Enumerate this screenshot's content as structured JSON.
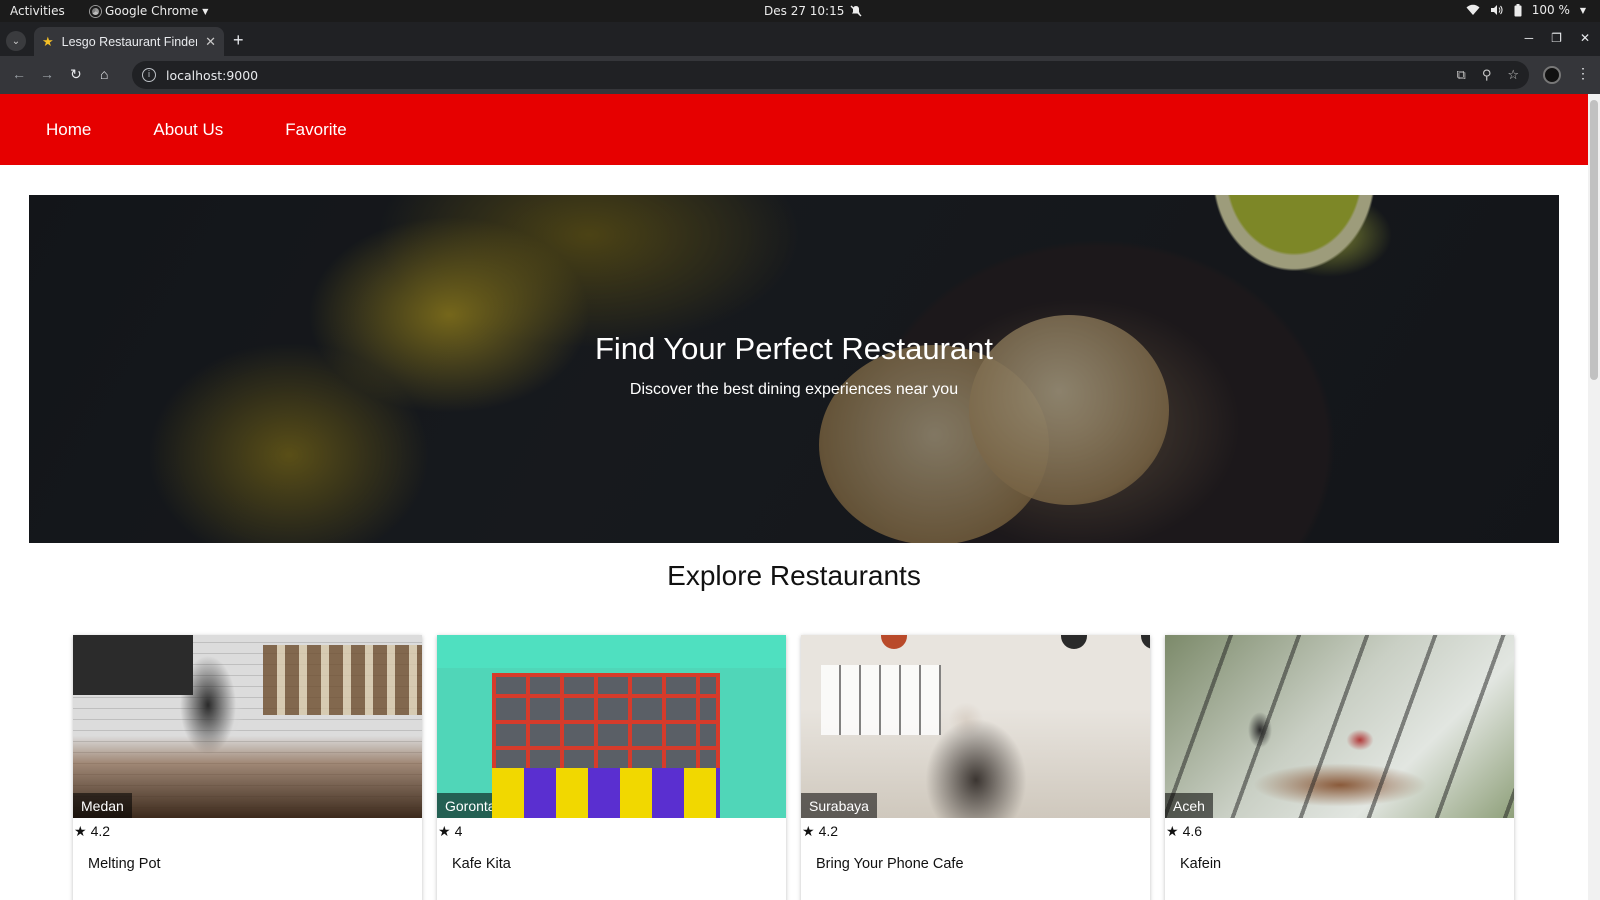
{
  "system_bar": {
    "activities": "Activities",
    "app_name": "Google Chrome",
    "datetime": "Des 27  10:15",
    "battery": "100 %"
  },
  "browser": {
    "tab_title": "Lesgo Restaurant Finder",
    "url": "localhost:9000"
  },
  "nav": {
    "items": [
      {
        "label": "Home"
      },
      {
        "label": "About Us"
      },
      {
        "label": "Favorite"
      }
    ]
  },
  "hero": {
    "title": "Find Your Perfect Restaurant",
    "subtitle": "Discover the best dining experiences near you"
  },
  "explore": {
    "title": "Explore Restaurants",
    "restaurants": [
      {
        "city": "Medan",
        "rating": "4.2",
        "name": "Melting Pot"
      },
      {
        "city": "Gorontalo",
        "rating": "4",
        "name": "Kafe Kita"
      },
      {
        "city": "Surabaya",
        "rating": "4.2",
        "name": "Bring Your Phone Cafe"
      },
      {
        "city": "Aceh",
        "rating": "4.6",
        "name": "Kafein"
      }
    ]
  },
  "icons": {
    "rating": "star-icon",
    "favicon": "star-icon"
  },
  "colors": {
    "nav_bg": "#e60000",
    "favicon": "#f6c026"
  }
}
